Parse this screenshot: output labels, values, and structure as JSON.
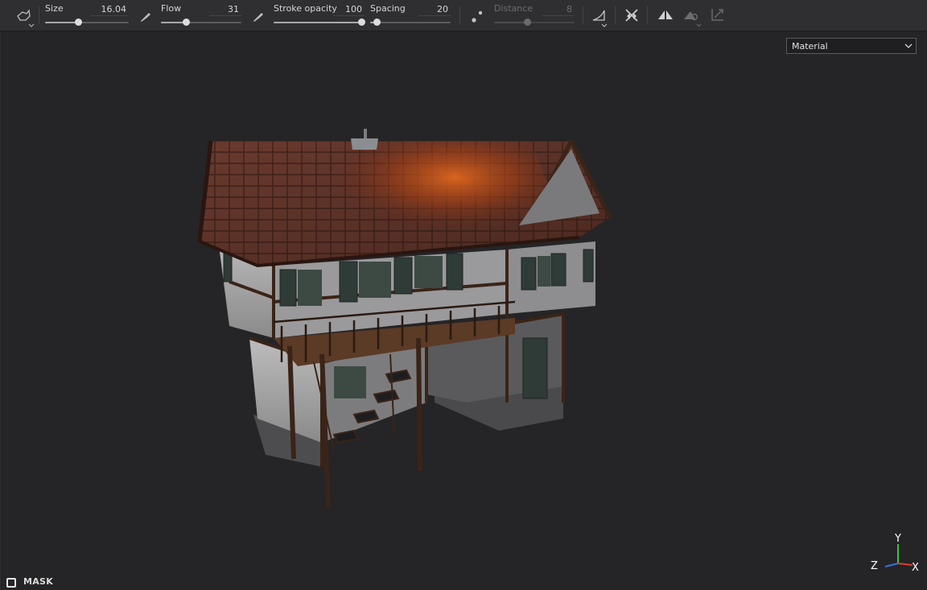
{
  "toolbar": {
    "size": {
      "label": "Size",
      "value": "16.04",
      "level": 0.4
    },
    "flow": {
      "label": "Flow",
      "value": "31",
      "level": 0.31
    },
    "stroke_opacity": {
      "label": "Stroke opacity",
      "value": "100",
      "level": 1.0
    },
    "spacing": {
      "label": "Spacing",
      "value": "20",
      "level": 0.1
    },
    "distance": {
      "label": "Distance",
      "value": "8",
      "level": 0.4
    },
    "icons": [
      "brush-preset-icon",
      "pen-pressure-icon",
      "lazy-mouse-icon",
      "alignment-icon",
      "symmetry-off-icon",
      "symmetry-icon",
      "fill-projection-icon",
      "transform-icon"
    ]
  },
  "viewport": {
    "channel_dropdown": {
      "selected": "Material"
    },
    "mask_label": "MASK",
    "axis": {
      "y": "Y",
      "z": "Z",
      "x": "X"
    },
    "colors": {
      "axis_x": "#e03a3a",
      "axis_y": "#3ac43a",
      "axis_z": "#3a6fe0"
    }
  }
}
